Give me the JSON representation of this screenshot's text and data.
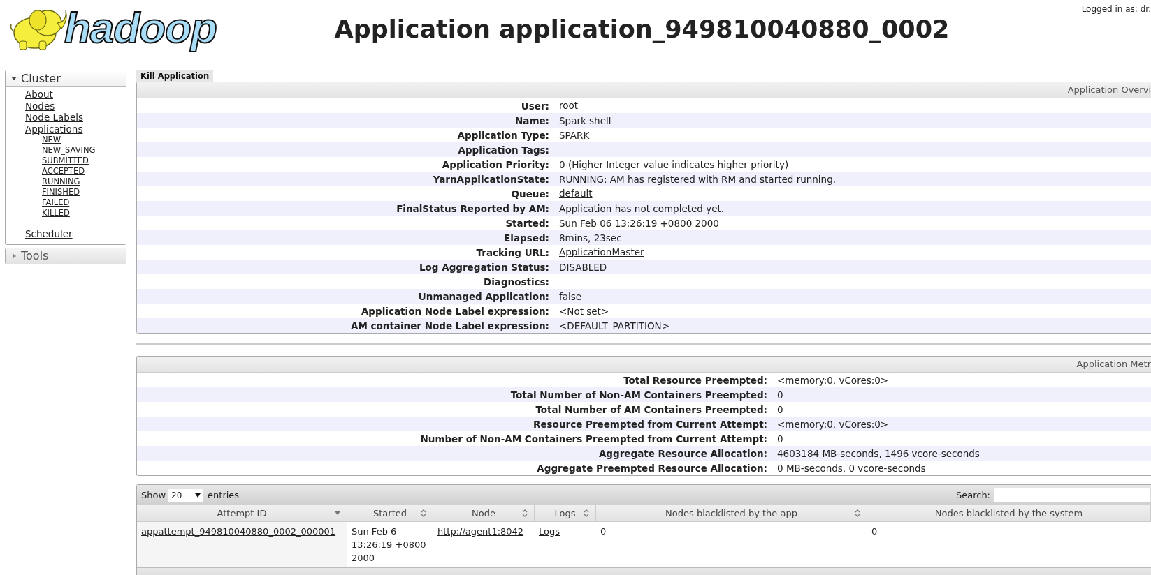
{
  "header": {
    "logo_text": "hadoop",
    "title": "Application application_949810040880_0002",
    "logged_in": "Logged in as: dr."
  },
  "sidebar": [
    {
      "label": "Cluster",
      "expanded": true,
      "items": [
        {
          "label": "About"
        },
        {
          "label": "Nodes"
        },
        {
          "label": "Node Labels"
        },
        {
          "label": "Applications",
          "children": [
            {
              "label": "NEW"
            },
            {
              "label": "NEW_SAVING"
            },
            {
              "label": "SUBMITTED"
            },
            {
              "label": "ACCEPTED"
            },
            {
              "label": "RUNNING"
            },
            {
              "label": "FINISHED"
            },
            {
              "label": "FAILED"
            },
            {
              "label": "KILLED"
            }
          ]
        },
        {
          "label": "Scheduler"
        }
      ]
    },
    {
      "label": "Tools",
      "expanded": false
    }
  ],
  "kill_button": "Kill Application",
  "overview": {
    "heading": "Application Overvi",
    "rows": [
      {
        "label": "User:",
        "value": "root",
        "link": true
      },
      {
        "label": "Name:",
        "value": "Spark shell",
        "link": false
      },
      {
        "label": "Application Type:",
        "value": "SPARK",
        "link": false
      },
      {
        "label": "Application Tags:"
      },
      {
        "label": "Application Priority:",
        "value": "0 (Higher Integer value indicates higher priority)",
        "link": false
      },
      {
        "label": "YarnApplicationState:",
        "value": "RUNNING: AM has registered with RM and started running.",
        "link": false
      },
      {
        "label": "Queue:",
        "value": "default",
        "link": true
      },
      {
        "label": "FinalStatus Reported by AM:",
        "value": "Application has not completed yet.",
        "link": false
      },
      {
        "label": "Started:",
        "value": "Sun Feb 06 13:26:19 +0800 2000",
        "link": false
      },
      {
        "label": "Elapsed:",
        "value": "8mins, 23sec",
        "link": false
      },
      {
        "label": "Tracking URL:",
        "value": "ApplicationMaster",
        "link": true
      },
      {
        "label": "Log Aggregation Status:",
        "value": "DISABLED",
        "link": false
      },
      {
        "label": "Diagnostics:"
      },
      {
        "label": "Unmanaged Application:",
        "value": "false",
        "link": false
      },
      {
        "label": "Application Node Label expression:",
        "value": "<Not set>",
        "link": false
      },
      {
        "label": "AM container Node Label expression:",
        "value": "<DEFAULT_PARTITION>",
        "link": false
      }
    ]
  },
  "metrics": {
    "heading": "Application Metr",
    "rows": [
      {
        "label": "Total Resource Preempted:",
        "value": "<memory:0, vCores:0>"
      },
      {
        "label": "Total Number of Non-AM Containers Preempted:",
        "value": "0"
      },
      {
        "label": "Total Number of AM Containers Preempted:",
        "value": "0"
      },
      {
        "label": "Resource Preempted from Current Attempt:",
        "value": "<memory:0, vCores:0>"
      },
      {
        "label": "Number of Non-AM Containers Preempted from Current Attempt:",
        "value": "0"
      },
      {
        "label": "Aggregate Resource Allocation:",
        "value": "4603184 MB-seconds, 1496 vcore-seconds"
      },
      {
        "label": "Aggregate Preempted Resource Allocation:",
        "value": "0 MB-seconds, 0 vcore-seconds"
      }
    ]
  },
  "attempts": {
    "show_label": "Show",
    "page_size": "20",
    "entries_label": "entries",
    "search_label": "Search:",
    "columns": [
      {
        "label": "Attempt ID",
        "sortable": true,
        "sorted": true
      },
      {
        "label": "Started",
        "sortable": true,
        "sorted": false
      },
      {
        "label": "Node",
        "sortable": true,
        "sorted": false
      },
      {
        "label": "Logs",
        "sortable": true,
        "sorted": false
      },
      {
        "label": "Nodes blacklisted by the app",
        "sortable": true,
        "sorted": false
      },
      {
        "label": "Nodes blacklisted by the system",
        "sortable": false,
        "sorted": false
      }
    ],
    "rows": [
      [
        {
          "text": "appattempt_949810040880_0002_000001",
          "link": true
        },
        {
          "text": "Sun Feb 6 13:26:19 +0800 2000",
          "link": false
        },
        {
          "text": "http://agent1:8042",
          "link": true
        },
        {
          "text": "Logs",
          "link": true
        },
        {
          "text": "0",
          "link": false
        },
        {
          "text": "0",
          "link": false
        }
      ]
    ]
  }
}
